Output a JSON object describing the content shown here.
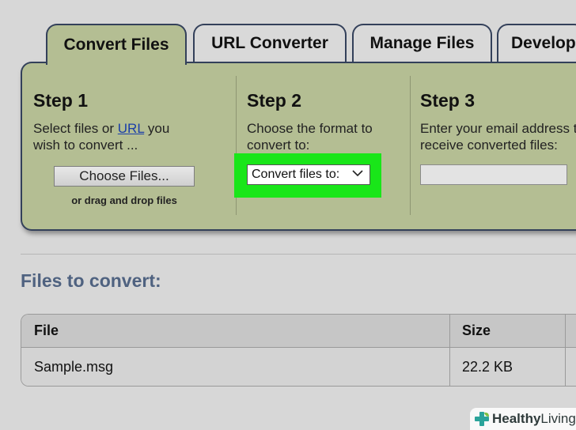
{
  "tabs": [
    {
      "label": "Convert Files",
      "active": true
    },
    {
      "label": "URL Converter",
      "active": false
    },
    {
      "label": "Manage Files",
      "active": false
    },
    {
      "label": "Developers",
      "active": false
    }
  ],
  "steps": {
    "step1": {
      "title": "Step 1",
      "desc_before_link": "Select files or ",
      "link": "URL",
      "desc_after_link": " you",
      "desc_line2": "wish to convert ...",
      "button_label": "Choose Files...",
      "drag_note": "or drag and drop files"
    },
    "step2": {
      "title": "Step 2",
      "desc_line1": "Choose the format to",
      "desc_line2": "convert to:",
      "select_value": "Convert files to:"
    },
    "step3": {
      "title": "Step 3",
      "desc_line1": "Enter your email address to",
      "desc_line2": "receive converted files:",
      "email_value": ""
    }
  },
  "files_section": {
    "title": "Files to convert:",
    "columns": [
      "File",
      "Size"
    ],
    "rows": [
      {
        "file": "Sample.msg",
        "size": "22.2 KB"
      }
    ]
  },
  "watermark": {
    "bold": "Healthy",
    "light": " Living"
  },
  "colors": {
    "panel_bg": "#b4be93",
    "highlight": "#19e619",
    "heading_blue": "#4f6280"
  },
  "icons": {
    "select_chevron": "chevron-down-icon",
    "watermark_logo": "plus-leaf-icon"
  }
}
